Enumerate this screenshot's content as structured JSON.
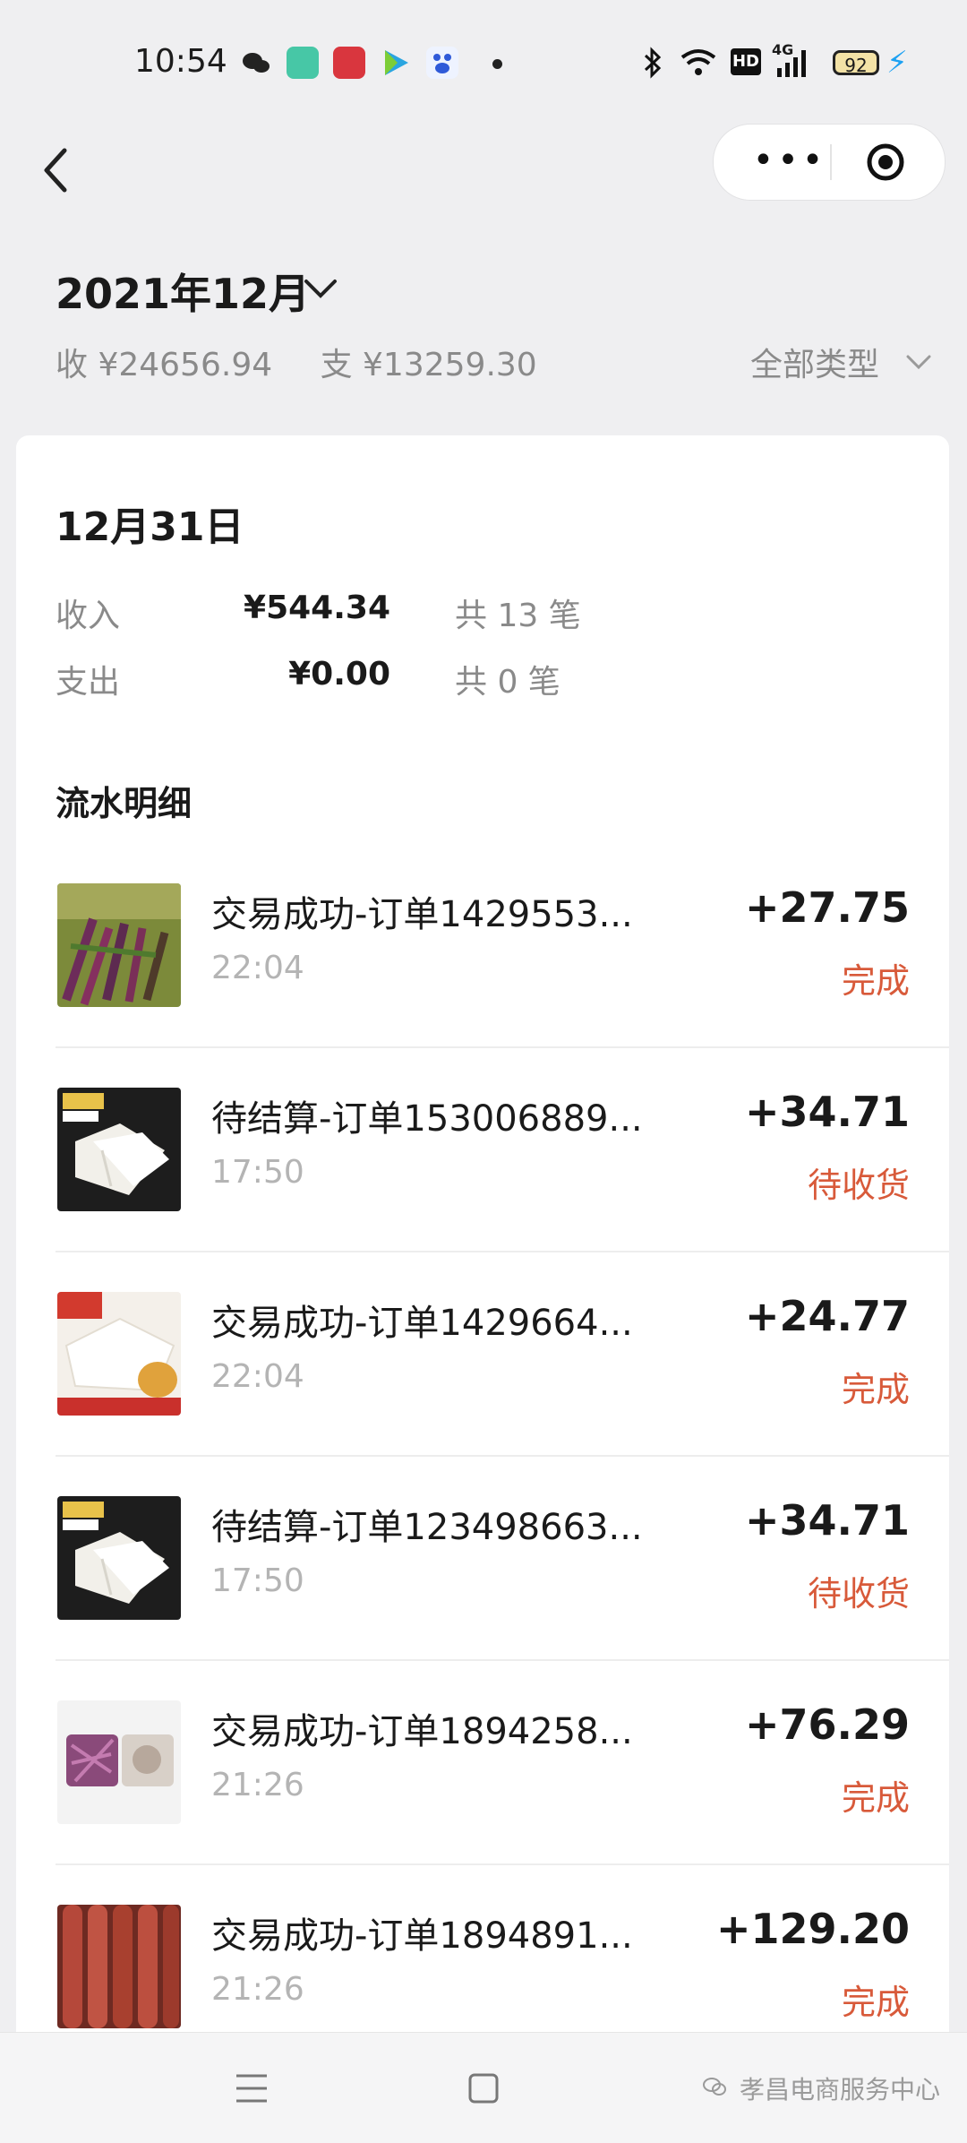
{
  "status_bar": {
    "time": "10:54",
    "network": "4G",
    "hd": "HD",
    "battery": "92",
    "icons": [
      "wechat-icon",
      "app-icon-green",
      "app-icon-red",
      "app-icon-video",
      "app-icon-baidu",
      "bluetooth-icon",
      "wifi-icon",
      "signal-icon",
      "battery-icon",
      "charging-icon"
    ]
  },
  "header": {
    "month": "2021年12月",
    "income_label": "收 ¥24656.94",
    "expense_label": "支 ¥13259.30",
    "type_filter": "全部类型"
  },
  "day": {
    "title": "12月31日",
    "income_label": "收入",
    "income_value": "¥544.34",
    "income_count": "共 13 笔",
    "expense_label": "支出",
    "expense_value": "¥0.00",
    "expense_count": "共 0 笔"
  },
  "flow_title": "流水明细",
  "transactions": [
    {
      "title": "交易成功-订单1429553...",
      "time": "22:04",
      "amount": "+27.75",
      "status": "完成"
    },
    {
      "title": "待结算-订单153006889...",
      "time": "17:50",
      "amount": "+34.71",
      "status": "待收货"
    },
    {
      "title": "交易成功-订单1429664...",
      "time": "22:04",
      "amount": "+24.77",
      "status": "完成"
    },
    {
      "title": "待结算-订单123498663...",
      "time": "17:50",
      "amount": "+34.71",
      "status": "待收货"
    },
    {
      "title": "交易成功-订单1894258...",
      "time": "21:26",
      "amount": "+76.29",
      "status": "完成"
    },
    {
      "title": "交易成功-订单1894891...",
      "time": "21:26",
      "amount": "+129.20",
      "status": "完成"
    }
  ],
  "watermark": "孝昌电商服务中心",
  "colors": {
    "status_accent": "#d85a3a",
    "page_bg": "#efeff1",
    "card_bg": "#ffffff"
  }
}
